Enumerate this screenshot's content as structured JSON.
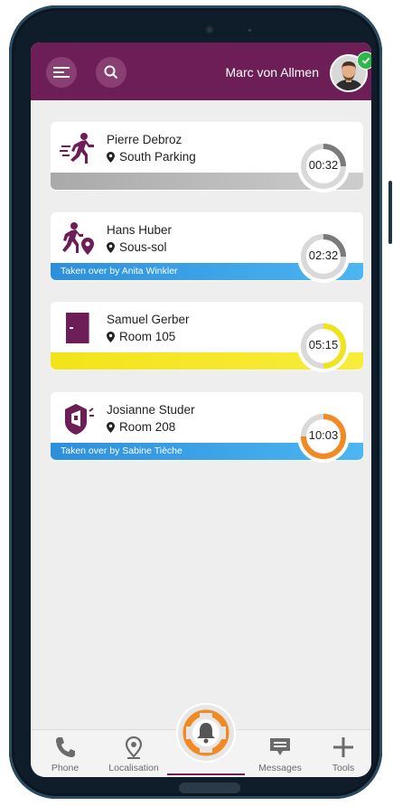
{
  "header": {
    "user_name": "Marc von Allmen",
    "menu_icon": "menu-icon",
    "search_icon": "search-icon",
    "status": "online",
    "colors": {
      "bar": "#6e1e57",
      "status_ok": "#2eb84b"
    }
  },
  "alarms": [
    {
      "name": "Pierre Debroz",
      "location": "South Parking",
      "timer": "00:32",
      "taken_over": "",
      "icon": "running-person-icon",
      "strip_color": "#b7b7b7",
      "ring_color": "#7a7a7a",
      "progress": 0.25
    },
    {
      "name": "Hans Huber",
      "location": "Sous-sol",
      "timer": "02:32",
      "taken_over": "Taken over by Anita Winkler",
      "icon": "running-person-location-icon",
      "strip_color": "#2f9fe4",
      "ring_color": "#7a7a7a",
      "progress": 0.25
    },
    {
      "name": "Samuel Gerber",
      "location": "Room 105",
      "timer": "05:15",
      "taken_over": "",
      "icon": "door-icon",
      "strip_color": "#f4e81c",
      "ring_color": "#f1e31a",
      "progress": 0.5
    },
    {
      "name": "Josianne Studer",
      "location": "Room 208",
      "timer": "10:03",
      "taken_over": "Taken over by Sabine Tièche",
      "icon": "shield-alert-icon",
      "strip_color": "#2f9fe4",
      "ring_color": "#f28a24",
      "progress": 0.75
    }
  ],
  "nav": {
    "phone": "Phone",
    "localisation": "Localisation",
    "messages": "Messages",
    "tools": "Tools",
    "alarm_icon": "bell-alarm-icon",
    "alarm_color": "#f28a24"
  }
}
